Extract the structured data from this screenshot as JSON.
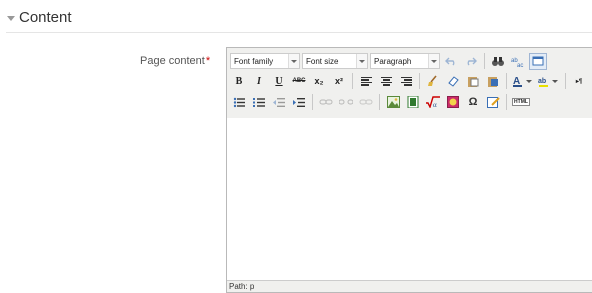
{
  "section": {
    "title": "Content"
  },
  "field": {
    "label": "Page content",
    "required_mark": "*"
  },
  "editor": {
    "toolbar": {
      "font_family": "Font family",
      "font_size": "Font size",
      "format": "Paragraph",
      "strike_label": "ABC",
      "html_label": "HTML",
      "ltr_label": "▸¶",
      "rtl_label": "¶◂",
      "sub_label": "x₂",
      "sup_label": "x²",
      "omega": "Ω"
    },
    "status_path": "Path: p"
  },
  "colors": {
    "toolbar_bg": "#f0f0ee",
    "required": "#cc0000"
  }
}
